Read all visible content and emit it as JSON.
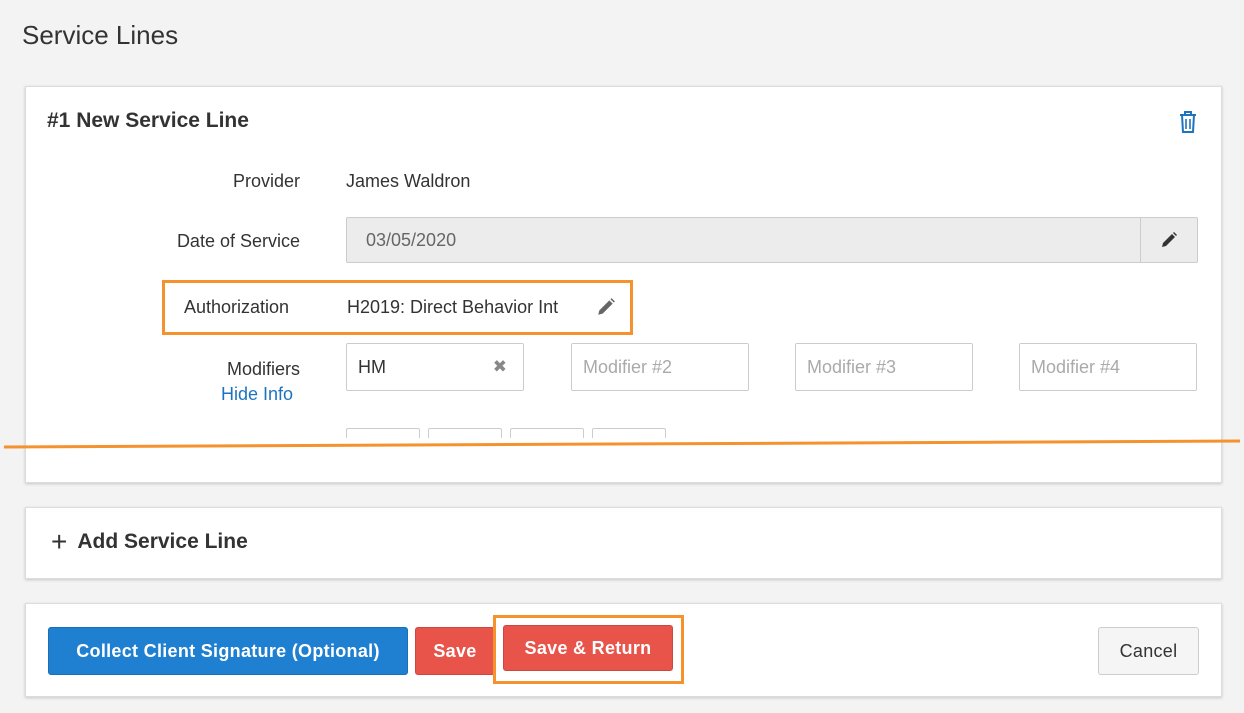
{
  "page": {
    "title": "Service Lines"
  },
  "service_line": {
    "heading": "#1 New Service Line",
    "delete_icon": "trash-icon",
    "provider_label": "Provider",
    "provider_value": "James Waldron",
    "date_label": "Date of Service",
    "date_value": "03/05/2020",
    "authorization_label": "Authorization",
    "authorization_value": "H2019: Direct Behavior Int",
    "modifiers_label": "Modifiers",
    "hide_info_link": "Hide Info",
    "modifier_1_value": "HM",
    "modifier_2_placeholder": "Modifier #2",
    "modifier_3_placeholder": "Modifier #3",
    "modifier_4_placeholder": "Modifier #4"
  },
  "add_service_line": {
    "label": "Add Service Line",
    "icon": "plus-icon"
  },
  "actions": {
    "collect_signature": "Collect Client Signature (Optional)",
    "save": "Save",
    "save_return": "Save & Return",
    "cancel": "Cancel"
  },
  "colors": {
    "primary": "#1f7fd0",
    "danger": "#e8534a",
    "highlight": "#f5922e",
    "link": "#1e73be"
  }
}
